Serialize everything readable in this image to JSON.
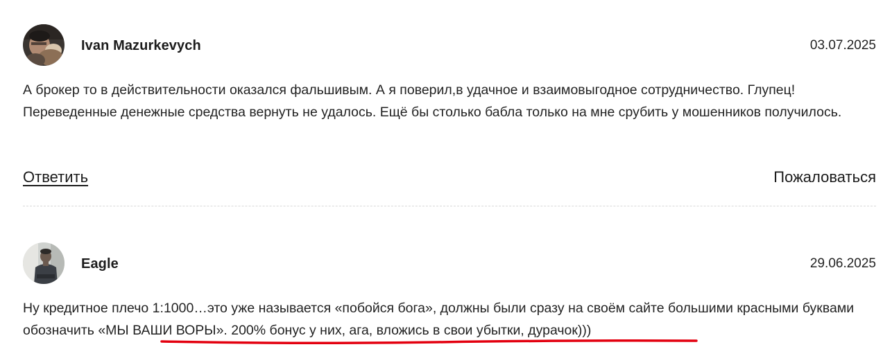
{
  "comments": [
    {
      "author": "Ivan Mazurkevych",
      "date": "03.07.2025",
      "text": "А брокер то в действительности оказался фальшивым. А я поверил,в удачное и взаимовыгодное сотрудничество. Глупец! Переведенные денежные средства вернуть не удалось. Ещё бы столько бабла только на мне срубить у мошенников получилось.",
      "reply_label": "Ответить",
      "report_label": "Пожаловаться"
    },
    {
      "author": "Eagle",
      "date": "29.06.2025",
      "text_before": "Ну кредитное плечо 1:1000…это уже называется «побойся бога», должны были сразу на своём сайте большими красными буквами обозначить ",
      "text_highlighted": "«МЫ ВАШИ ВОРЫ». 200% бонус у них, ага, вложись в свои убытки, дурачок)))"
    }
  ],
  "colors": {
    "highlight_underline": "#e3000f",
    "divider": "#d8d8d8"
  },
  "icons": {
    "avatar_1": "avatar-photo-ivan",
    "avatar_2": "avatar-photo-eagle"
  }
}
